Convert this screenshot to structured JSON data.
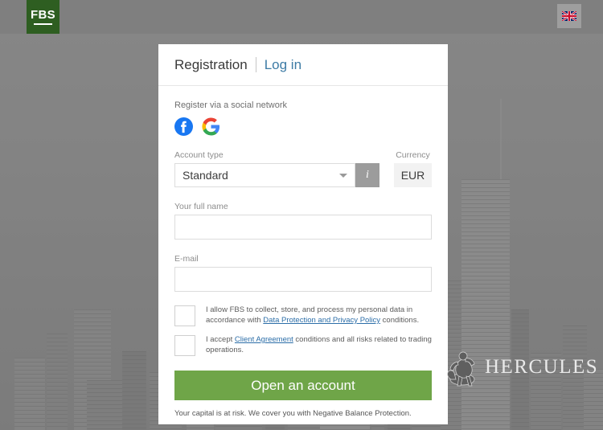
{
  "topbar": {
    "logo_text": "FBS",
    "logo_color": "#2e5e21",
    "language_icon": "uk-flag-icon"
  },
  "card": {
    "header": {
      "title": "Registration",
      "login_link": "Log in",
      "link_color": "#3d7ba5"
    },
    "social": {
      "label": "Register via a social network",
      "providers": [
        {
          "name": "facebook-icon",
          "color": "#1877f2"
        },
        {
          "name": "google-icon",
          "color": "#4285f4"
        }
      ]
    },
    "account_type": {
      "label": "Account type",
      "value": "Standard",
      "info_button_glyph": "i",
      "caret_icon": "chevron-down-icon"
    },
    "currency": {
      "label": "Currency",
      "value": "EUR"
    },
    "full_name": {
      "label": "Your full name",
      "value": "",
      "placeholder": ""
    },
    "email": {
      "label": "E-mail",
      "value": "",
      "placeholder": ""
    },
    "consents": [
      {
        "pre": "I allow FBS to collect, store, and process my personal data in accordance with ",
        "link": "Data Protection and Privacy Policy",
        "post": " conditions.",
        "checked": false
      },
      {
        "pre": "I accept ",
        "link": "Client Agreement",
        "post": " conditions and all risks related to trading operations.",
        "checked": false
      }
    ],
    "submit": {
      "label": "Open an account",
      "color": "#6fa548"
    },
    "disclaimer": "Your capital is at risk. We cover you with Negative Balance Protection."
  },
  "watermark": {
    "name": "HERCULES",
    "icon": "hercules-statue-icon"
  }
}
